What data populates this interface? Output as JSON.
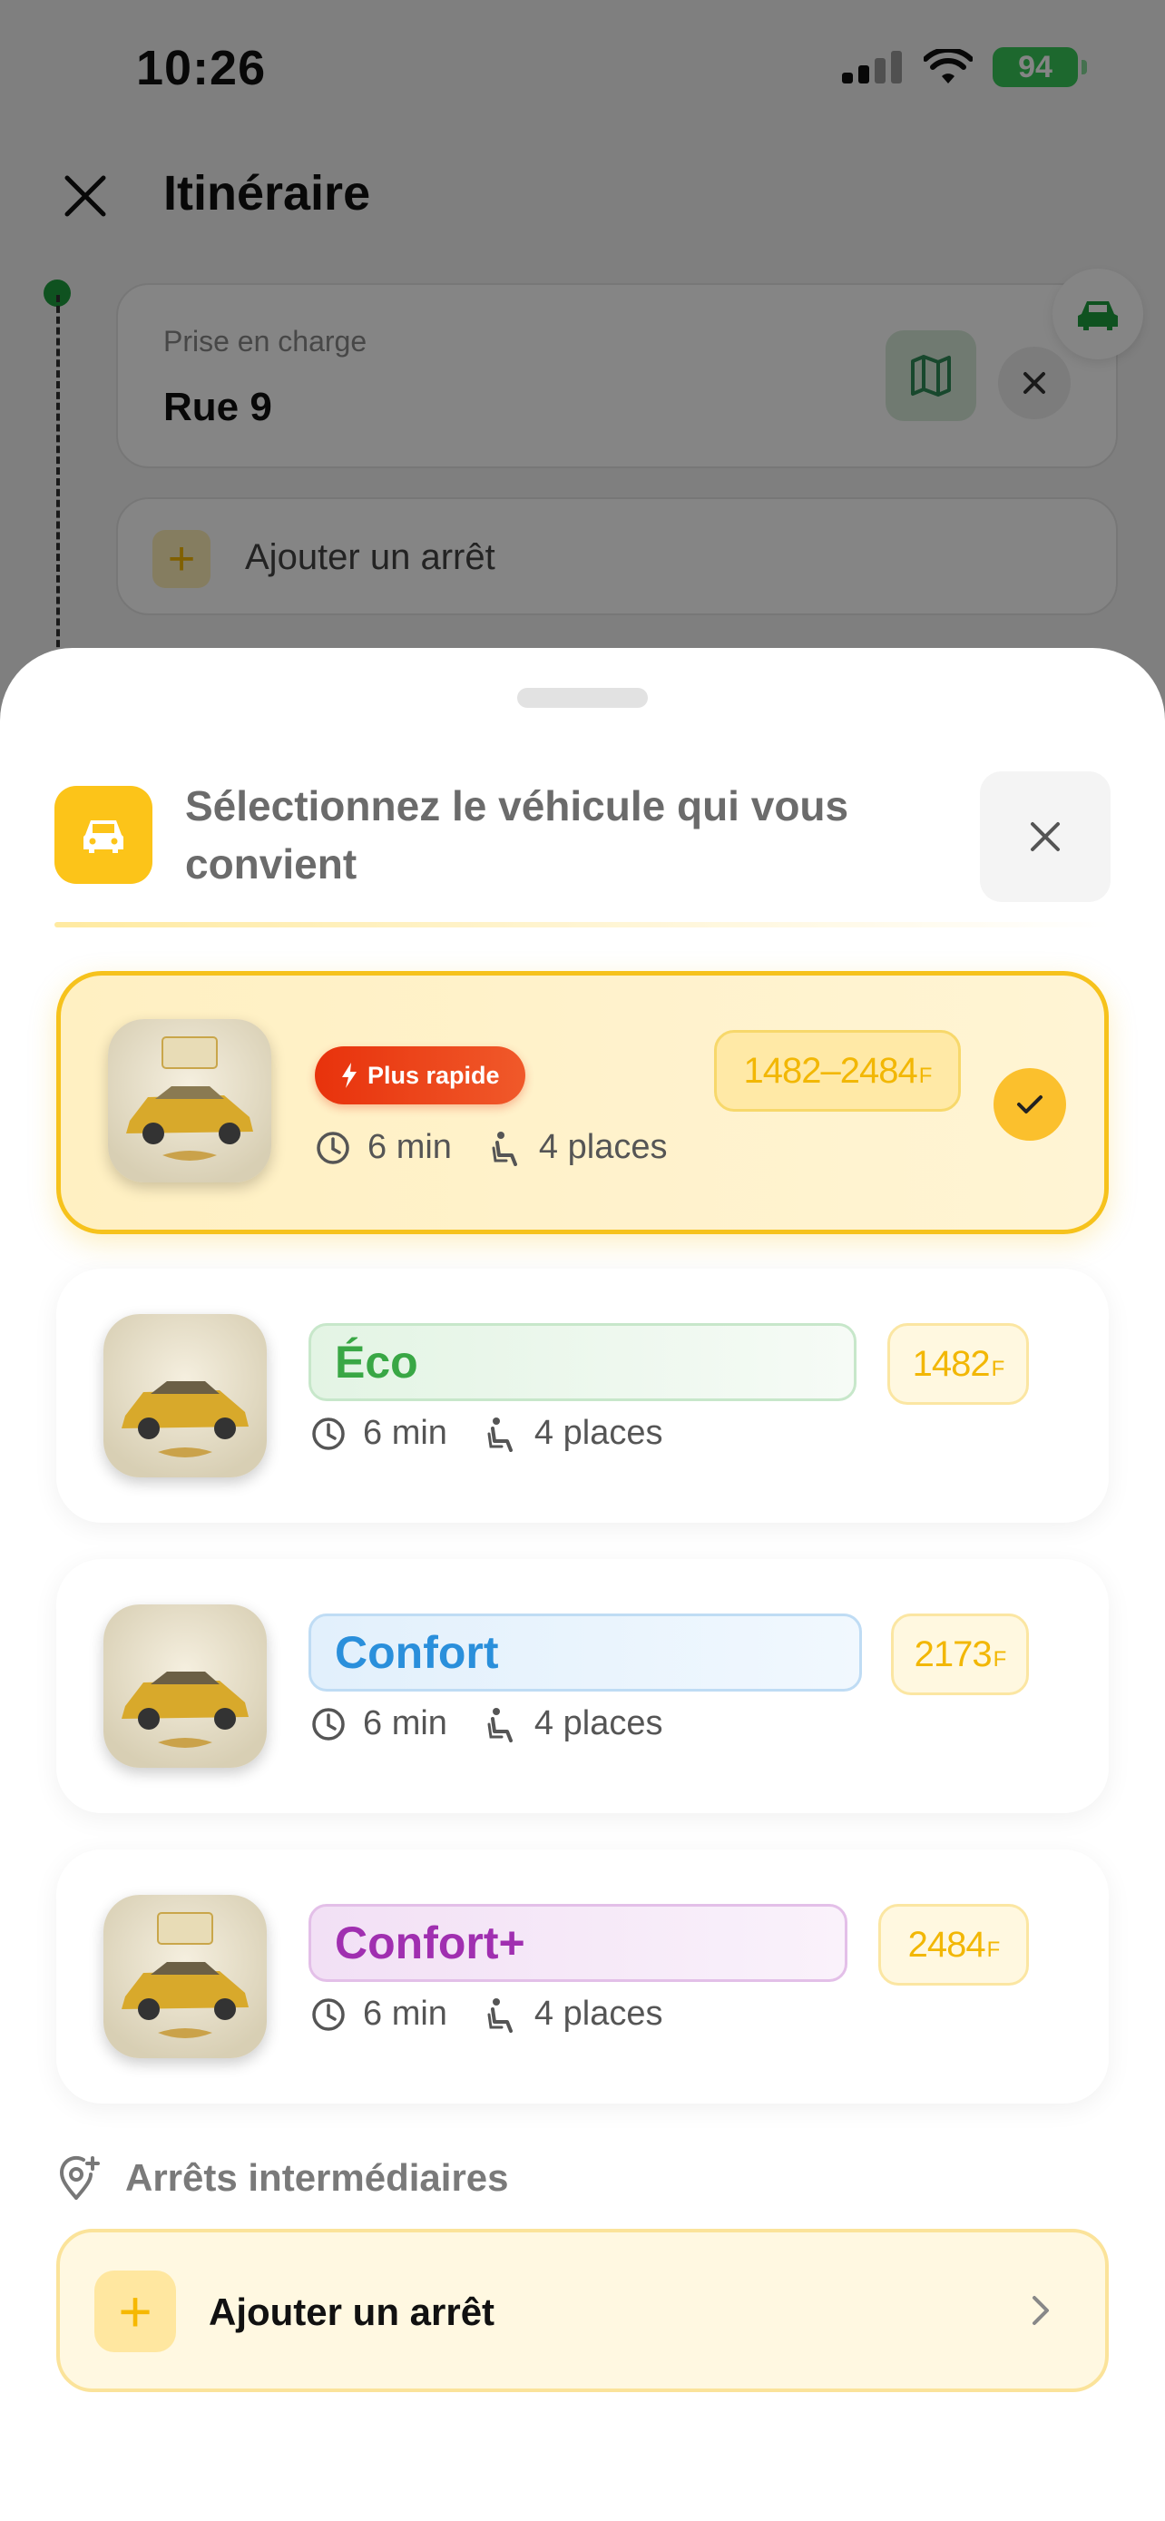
{
  "status_bar": {
    "time": "10:26",
    "battery": "94"
  },
  "top_bar": {
    "title": "Itinéraire"
  },
  "pickup": {
    "label": "Prise en charge",
    "value": "Rue 9"
  },
  "add_stop_top": {
    "label": "Ajouter un arrêt"
  },
  "sheet": {
    "title": "Sélectionnez le véhicule qui vous convient",
    "accent": "#fcc419"
  },
  "vehicles": [
    {
      "name": "Plus rapide",
      "badge": "Plus rapide",
      "eta": "6 min",
      "seats": "4 places",
      "price": "1482–2484",
      "currency": "F",
      "selected": true
    },
    {
      "name": "Éco",
      "eta": "6 min",
      "seats": "4 places",
      "price": "1482",
      "currency": "F",
      "color": "#39a745"
    },
    {
      "name": "Confort",
      "eta": "6 min",
      "seats": "4 places",
      "price": "2173",
      "currency": "F",
      "color": "#2a8fdb"
    },
    {
      "name": "Confort+",
      "eta": "6 min",
      "seats": "4 places",
      "price": "2484",
      "currency": "F",
      "color": "#a02fb0"
    }
  ],
  "intermediate_stops": {
    "title": "Arrêts intermédiaires",
    "add_label": "Ajouter un arrêt"
  }
}
